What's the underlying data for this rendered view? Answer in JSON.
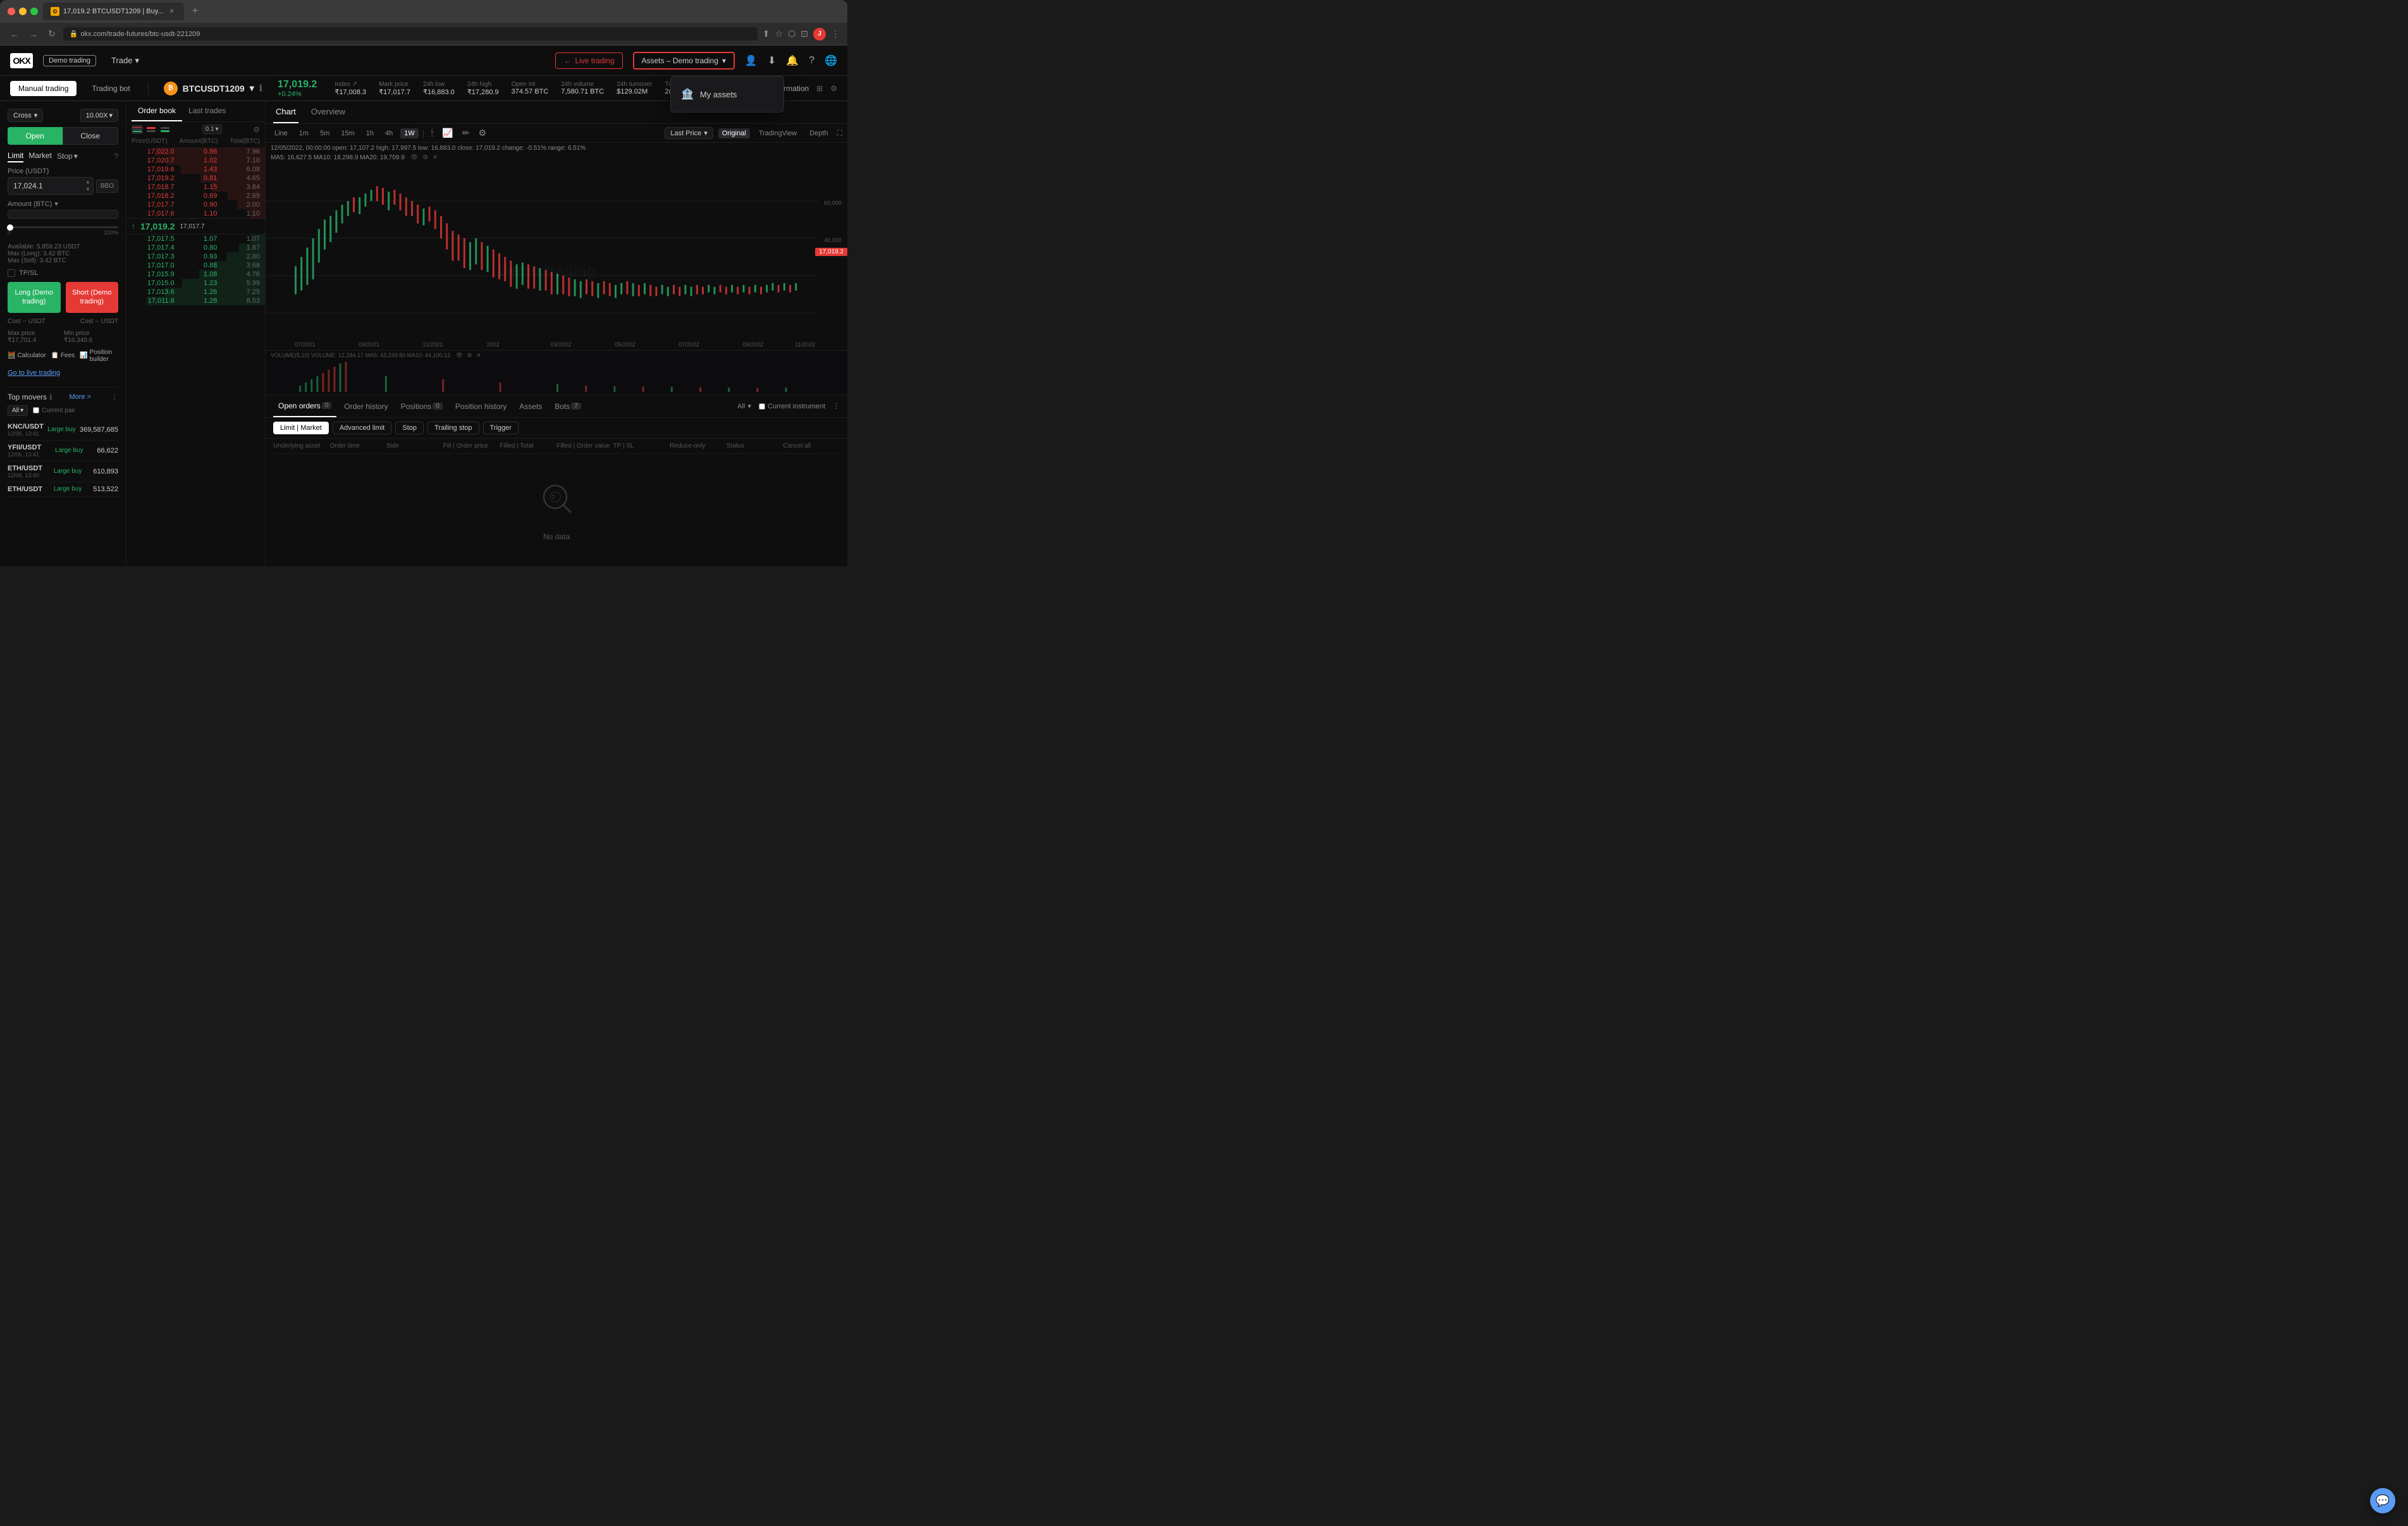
{
  "browser": {
    "tab_title": "17,019.2 BTCUSDT1209 | Buy...",
    "url": "okx.com/trade-futures/btc-usdt-221209",
    "new_tab_label": "+"
  },
  "top_nav": {
    "logo_text": "OKX",
    "demo_label": "Demo trading",
    "trade_label": "Trade",
    "live_trading_label": "Live trading",
    "assets_demo_label": "Assets – Demo trading",
    "dropdown": {
      "my_assets_label": "My assets"
    },
    "information_label": "Information"
  },
  "sub_nav": {
    "manual_trading_label": "Manual trading",
    "trading_bot_label": "Trading bot",
    "pair": "BTCUSDT1209",
    "price": "17,019.2",
    "price_change": "+0.24%",
    "stats": [
      {
        "label": "Index ↗",
        "value": "₹17,008.3"
      },
      {
        "label": "Mark price",
        "value": "₹17,017.7"
      },
      {
        "label": "24h low",
        "value": "₹16,883.0"
      },
      {
        "label": "24h high",
        "value": "₹17,280.9"
      },
      {
        "label": "Open int",
        "value": "374.57 BTC"
      },
      {
        "label": "24h volume",
        "value": "7,580.71 BTC"
      },
      {
        "label": "24h turnover",
        "value": "$129.02M"
      },
      {
        "label": "Time to delivery",
        "value": "2d"
      }
    ]
  },
  "left_panel": {
    "margin_label": "Cross",
    "leverage_label": "10.00X",
    "open_label": "Open",
    "close_label": "Close",
    "order_types": {
      "limit_label": "Limit",
      "market_label": "Market",
      "stop_label": "Stop"
    },
    "price_label": "Price (USDT)",
    "price_value": "17,024.1",
    "bbo_label": "BBO",
    "amount_label": "Amount (BTC)",
    "slider_pct": "0",
    "slider_max_label": "100%",
    "available_label": "Available: 5,859.23 USDT",
    "max_long_label": "Max (Long): 3.42 BTC",
    "max_sell_label": "Max (Sell): 3.42 BTC",
    "tpsl_label": "TP/SL",
    "long_btn_label": "Long (Demo trading)",
    "short_btn_label": "Short (Demo trading)",
    "cost_long_label": "Cost -- USDT",
    "cost_short_label": "Cost -- USDT",
    "max_price_long": "Max price ₹17,701.4",
    "min_price_short": "Min price ₹16,340.6",
    "calculator_label": "Calculator",
    "fees_label": "Fees",
    "position_builder_label": "Position builder",
    "go_live_label": "Go to live trading",
    "top_movers_title": "Top movers",
    "more_label": "More >",
    "filter_all_label": "All",
    "current_pair_label": "Current pair",
    "movers": [
      {
        "pair": "KNC/USDT",
        "date": "12/06, 13:41",
        "type": "Large buy",
        "value": "369,587,685"
      },
      {
        "pair": "YFII/USDT",
        "date": "12/06, 13:41",
        "type": "Large buy",
        "value": "66,622"
      },
      {
        "pair": "ETH/USDT",
        "date": "12/06, 13:40",
        "type": "Large buy",
        "value": "610,893"
      },
      {
        "pair": "ETH/USDT",
        "date": "",
        "type": "Large buy",
        "value": "513,522"
      }
    ]
  },
  "orderbook": {
    "tab_orderbook": "Order book",
    "tab_lasttrades": "Last trades",
    "size_label": "0.1",
    "col_price": "Price(USDT)",
    "col_amount": "Amount(BTC)",
    "col_total": "Total(BTC)",
    "sell_rows": [
      {
        "price": "17,022.0",
        "amount": "0.86",
        "total": "7.96"
      },
      {
        "price": "17,020.7",
        "amount": "1.02",
        "total": "7.10"
      },
      {
        "price": "17,019.6",
        "amount": "1.43",
        "total": "6.08"
      },
      {
        "price": "17,019.2",
        "amount": "0.81",
        "total": "4.65"
      },
      {
        "price": "17,018.7",
        "amount": "1.15",
        "total": "3.84"
      },
      {
        "price": "17,018.2",
        "amount": "0.69",
        "total": "2.69"
      },
      {
        "price": "17,017.7",
        "amount": "0.90",
        "total": "2.00"
      },
      {
        "price": "17,017.6",
        "amount": "1.10",
        "total": "1.10"
      }
    ],
    "mid_price": "17,019.2",
    "mid_arrow": "↑",
    "mid_tag": "17,017.7",
    "buy_rows": [
      {
        "price": "17,017.5",
        "amount": "1.07",
        "total": "1.07"
      },
      {
        "price": "17,017.4",
        "amount": "0.80",
        "total": "1.87"
      },
      {
        "price": "17,017.3",
        "amount": "0.93",
        "total": "2.80"
      },
      {
        "price": "17,017.0",
        "amount": "0.88",
        "total": "3.68"
      },
      {
        "price": "17,015.9",
        "amount": "1.08",
        "total": "4.76"
      },
      {
        "price": "17,015.0",
        "amount": "1.23",
        "total": "5.99"
      },
      {
        "price": "17,013.6",
        "amount": "1.26",
        "total": "7.25"
      },
      {
        "price": "17,011.8",
        "amount": "1.28",
        "total": "8.53"
      }
    ]
  },
  "chart": {
    "tab_chart": "Chart",
    "tab_overview": "Overview",
    "timeframes": [
      "Line",
      "1m",
      "5m",
      "15m",
      "1h",
      "4h",
      "1W"
    ],
    "active_tf": "1W",
    "last_price_label": "Last Price",
    "original_label": "Original",
    "tradingview_label": "TradingView",
    "depth_label": "Depth",
    "info_line": "12/05/2022, 00:00:00  open: 17,107.2  high: 17,997.5  low: 16,883.0  close: 17,019.2  change: -0.51%  range: 6.51%",
    "ma_line": "MA5: 16,627.5  MA10: 18,298.9  MA20: 19,709.9",
    "price_tag": "17,019.2",
    "vol_label": "VOLUME(5,10)  VOLUME: 12,284.17  MA5: 43,239.80  MA10: 44,100.13",
    "x_labels": [
      "07/2021",
      "09/2021",
      "11/2021",
      "2022",
      "03/2022",
      "05/2022",
      "07/2022",
      "09/2022",
      "11/2022"
    ],
    "y_labels": [
      "60,000.0",
      "40,000.0"
    ],
    "demo_watermark": "Demo trading"
  },
  "bottom_panel": {
    "tabs": [
      {
        "label": "Open orders",
        "count": "0"
      },
      {
        "label": "Order history"
      },
      {
        "label": "Positions",
        "count": "0"
      },
      {
        "label": "Position history"
      },
      {
        "label": "Assets"
      },
      {
        "label": "Bots",
        "count": "7"
      }
    ],
    "all_label": "All",
    "current_instrument_label": "Current instrument",
    "filter_buttons": [
      "Limit | Market",
      "Advanced limit",
      "Stop",
      "Trailing stop",
      "Trigger"
    ],
    "table_headers": [
      "Underlying asset",
      "Order time",
      "Side",
      "Fill | Order price",
      "Filled | Total",
      "Filled | Order value",
      "TP | SL",
      "Reduce-only",
      "Status",
      "Cancel all"
    ],
    "no_data_text": "No data"
  }
}
